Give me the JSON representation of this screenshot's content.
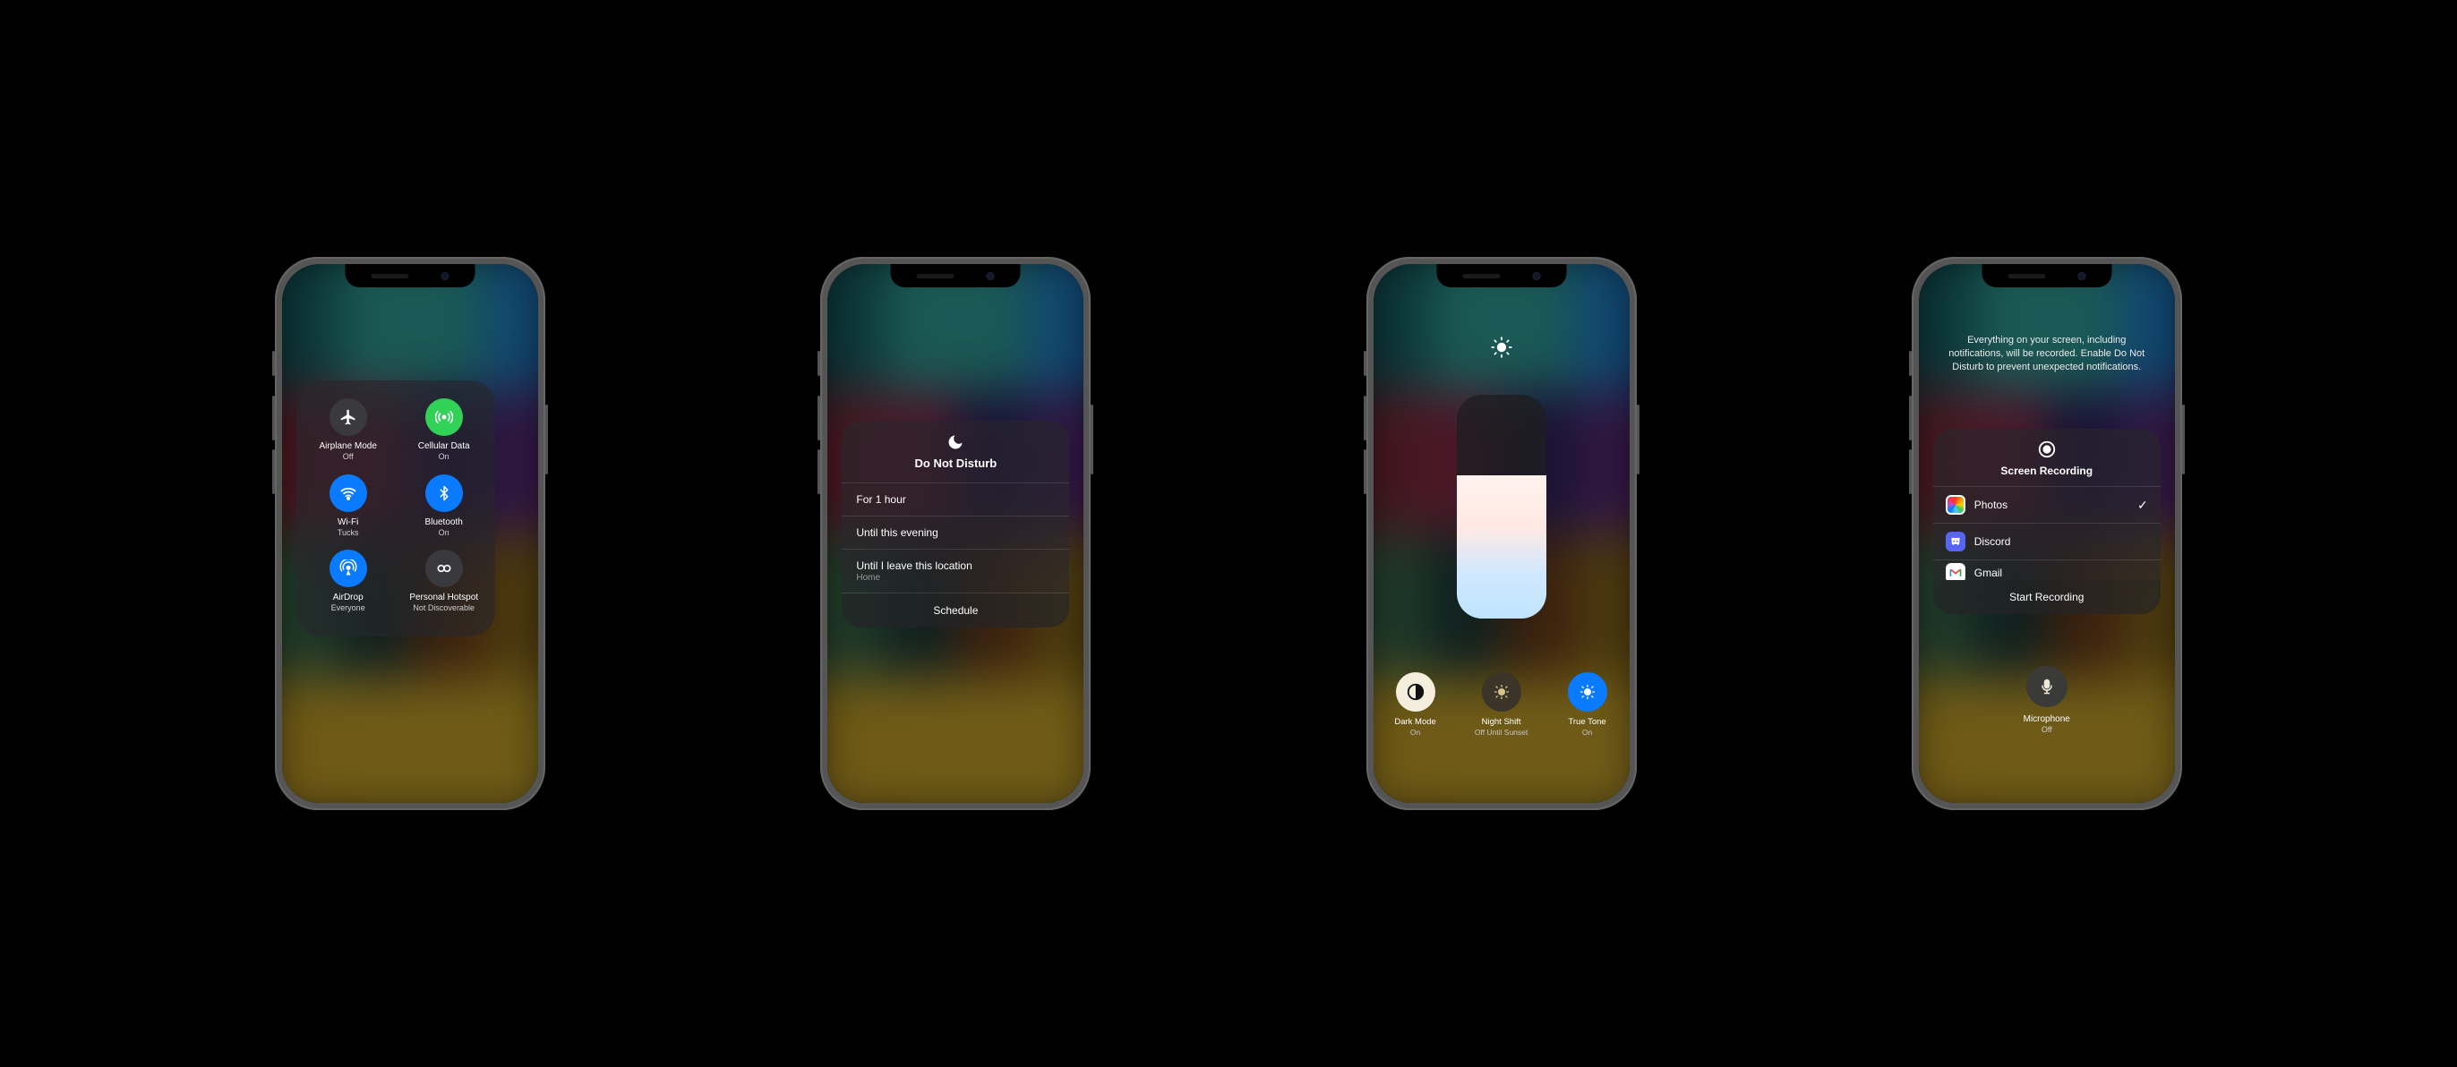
{
  "phone1": {
    "tiles": [
      {
        "key": "airplane",
        "label": "Airplane Mode",
        "sub": "Off"
      },
      {
        "key": "cellular",
        "label": "Cellular Data",
        "sub": "On"
      },
      {
        "key": "wifi",
        "label": "Wi-Fi",
        "sub": "Tucks"
      },
      {
        "key": "bluetooth",
        "label": "Bluetooth",
        "sub": "On"
      },
      {
        "key": "airdrop",
        "label": "AirDrop",
        "sub": "Everyone"
      },
      {
        "key": "hotspot",
        "label": "Personal Hotspot",
        "sub": "Not Discoverable"
      }
    ]
  },
  "phone2": {
    "title": "Do Not Disturb",
    "options": [
      {
        "label": "For 1 hour",
        "sub": ""
      },
      {
        "label": "Until this evening",
        "sub": ""
      },
      {
        "label": "Until I leave this location",
        "sub": "Home"
      }
    ],
    "schedule_label": "Schedule"
  },
  "phone3": {
    "brightness_percent": 64,
    "tiles": [
      {
        "key": "dark",
        "label": "Dark Mode",
        "sub": "On"
      },
      {
        "key": "night",
        "label": "Night Shift",
        "sub": "Off Until Sunset"
      },
      {
        "key": "tone",
        "label": "True Tone",
        "sub": "On"
      }
    ]
  },
  "phone4": {
    "description": "Everything on your screen, including notifications, will be recorded. Enable Do Not Disturb to prevent unexpected notifications.",
    "title": "Screen Recording",
    "apps": [
      {
        "name": "Photos",
        "selected": true,
        "icon": "photos"
      },
      {
        "name": "Discord",
        "selected": false,
        "icon": "discord"
      },
      {
        "name": "Gmail",
        "selected": false,
        "icon": "gmail"
      }
    ],
    "start_label": "Start Recording",
    "mic": {
      "label": "Microphone",
      "sub": "Off"
    },
    "check_glyph": "✓"
  },
  "bg_rows": [
    [
      "#155e63",
      "#2fa29a",
      "#2fa29a",
      "#1e7fcc"
    ],
    [
      "#7c2a3a",
      "#8a2a4a",
      "#2a225e",
      "#5a2a7a"
    ],
    [
      "#3a6a4a",
      "#1a3a3a",
      "#6a3a1a",
      "#8a6a1a"
    ],
    [
      "#c9a227",
      "#caa62a",
      "#caa62a",
      "#caa62a"
    ]
  ]
}
